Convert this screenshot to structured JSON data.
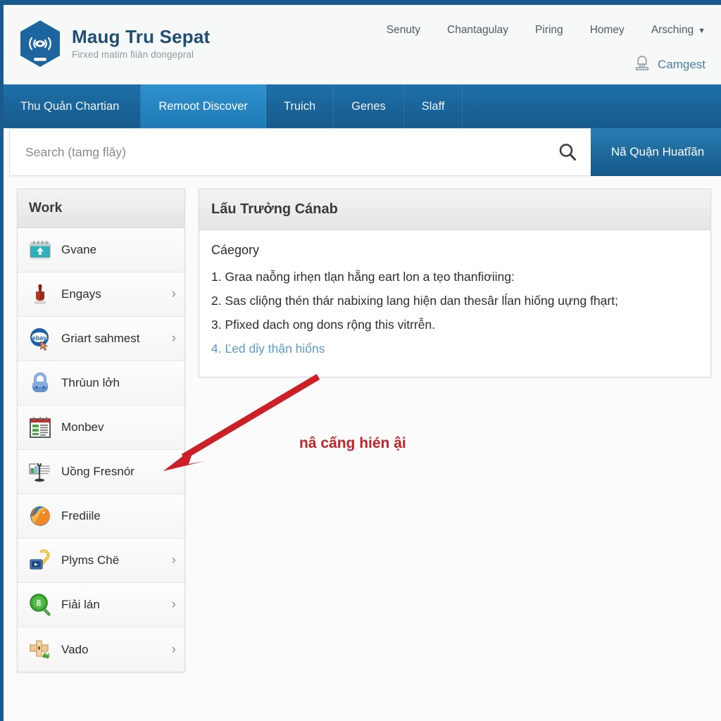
{
  "brand": {
    "title": "Maug Tru Sepat",
    "tagline": "Firxed matim fiiàn dongepral",
    "logo_icon": "hexagon-signal-icon"
  },
  "header": {
    "top_links": [
      {
        "label": "Senuty",
        "icon": null
      },
      {
        "label": "Chantagulay",
        "icon": null
      },
      {
        "label": "Piring",
        "icon": null
      },
      {
        "label": "Homey",
        "icon": null
      },
      {
        "label": "Arsching",
        "icon": "chevron-down-icon"
      }
    ],
    "user": {
      "label": "Camgest",
      "icon": "user-avatar-icon"
    }
  },
  "nav": {
    "items": [
      {
        "label": "Thu Quản Chartian",
        "active": false
      },
      {
        "label": "Remoot Discover",
        "active": true
      },
      {
        "label": "Truich",
        "active": false
      },
      {
        "label": "Genes",
        "active": false
      },
      {
        "label": "Slaff",
        "active": false
      }
    ]
  },
  "search": {
    "placeholder": "Search (tamg flǎy)",
    "value": "",
    "icon": "search-icon",
    "submit_label": "Nã Quận Huatĩãn"
  },
  "sidebar": {
    "title": "Work",
    "items": [
      {
        "label": "Gvane",
        "icon": "calendar-upload-icon",
        "chevron": false
      },
      {
        "label": "Engays",
        "icon": "stamp-seal-icon",
        "chevron": true
      },
      {
        "label": "Griart sahmest",
        "icon": "ebay-cursor-icon",
        "chevron": true
      },
      {
        "label": "Thrùun lởh",
        "icon": "padlock-icon",
        "chevron": false
      },
      {
        "label": "Monbev",
        "icon": "spreadsheet-icon",
        "chevron": false
      },
      {
        "label": "Uồng Fresnór",
        "icon": "document-stand-icon",
        "chevron": false
      },
      {
        "label": "Frediile",
        "icon": "firefox-icon",
        "chevron": false
      },
      {
        "label": "Plyms Chë",
        "icon": "video-ribbon-icon",
        "chevron": true
      },
      {
        "label": "Fiải lán",
        "icon": "green-magnifier-icon",
        "chevron": true
      },
      {
        "label": "Vado",
        "icon": "signpost-icon",
        "chevron": true
      }
    ]
  },
  "panel": {
    "title": "Lấu Trưởng Cánab",
    "category_label": "Cáegory",
    "steps": [
      {
        "text": "1. Graa naỗng irhẹn tlạn hẵng eart lon a tẹo thanfiơiing:",
        "link": false
      },
      {
        "text": "2. Sas cliộng thén thár nabixing lang hiện dan thesâr lĺan hiống uựng fhạrt;",
        "link": false
      },
      {
        "text": "3. Pfixed dach ong dons rộng this vitrrễn.",
        "link": false
      },
      {
        "text": "4. Ľed dỉy thận hiổns",
        "link": true
      }
    ]
  },
  "annotation": {
    "text": "nâ cấng hién ậi",
    "arrow_icon": "red-arrow-icon",
    "color": "#c0252a"
  },
  "colors": {
    "frame_blue": "#1b5a8e",
    "nav_blue": "#1e6fa8",
    "nav_active": "#2f91cf",
    "brand_blue": "#1f4e73",
    "link_blue": "#5b9bc4",
    "annotation_red": "#c0252a"
  }
}
